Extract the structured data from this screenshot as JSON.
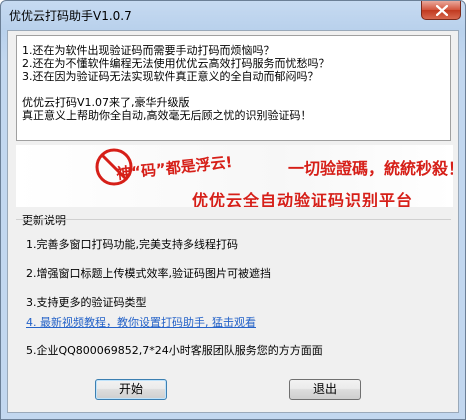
{
  "window": {
    "title": "优优云打码助手V1.0.7",
    "title_faded": "",
    "close_label": "关闭"
  },
  "intro": {
    "lines": [
      "1.还在为软件出现验证码而需要手动打码而烦恼吗？",
      "2.还在为不懂软件编程无法使用优优云高效打码服务而忧愁吗？",
      "3.还在因为验证码无法实现软件真正意义的全自动而郁闷吗？"
    ],
    "release_line": "优优云打码V1.07来了,豪华升级版",
    "tagline": "真正意义上帮助你全自动,高效毫无后顾之忧的识别验证码！"
  },
  "banner": {
    "slogan": "神“码”都是浮云!",
    "right_text": "一切验證碼，統統秒殺！",
    "platform": "优优云全自动验证码识别平台"
  },
  "updates": {
    "title": "更新说明",
    "items": [
      "1.完善多窗口打码功能,完美支持多线程打码",
      "2.增强窗口标题上传模式效率,验证码图片可被遮挡",
      "3.支持更多的验证码类型",
      "4. 最新视频教程，教你设置打码助手, 猛击观看",
      "5.企业QQ800069852,7*24小时客服团队服务您的方方面面"
    ]
  },
  "buttons": {
    "start": "开始",
    "exit": "退出"
  },
  "colors": {
    "titlebar": "#c6daf1",
    "link": "#2462c8",
    "banner_red": "#d61f18"
  }
}
